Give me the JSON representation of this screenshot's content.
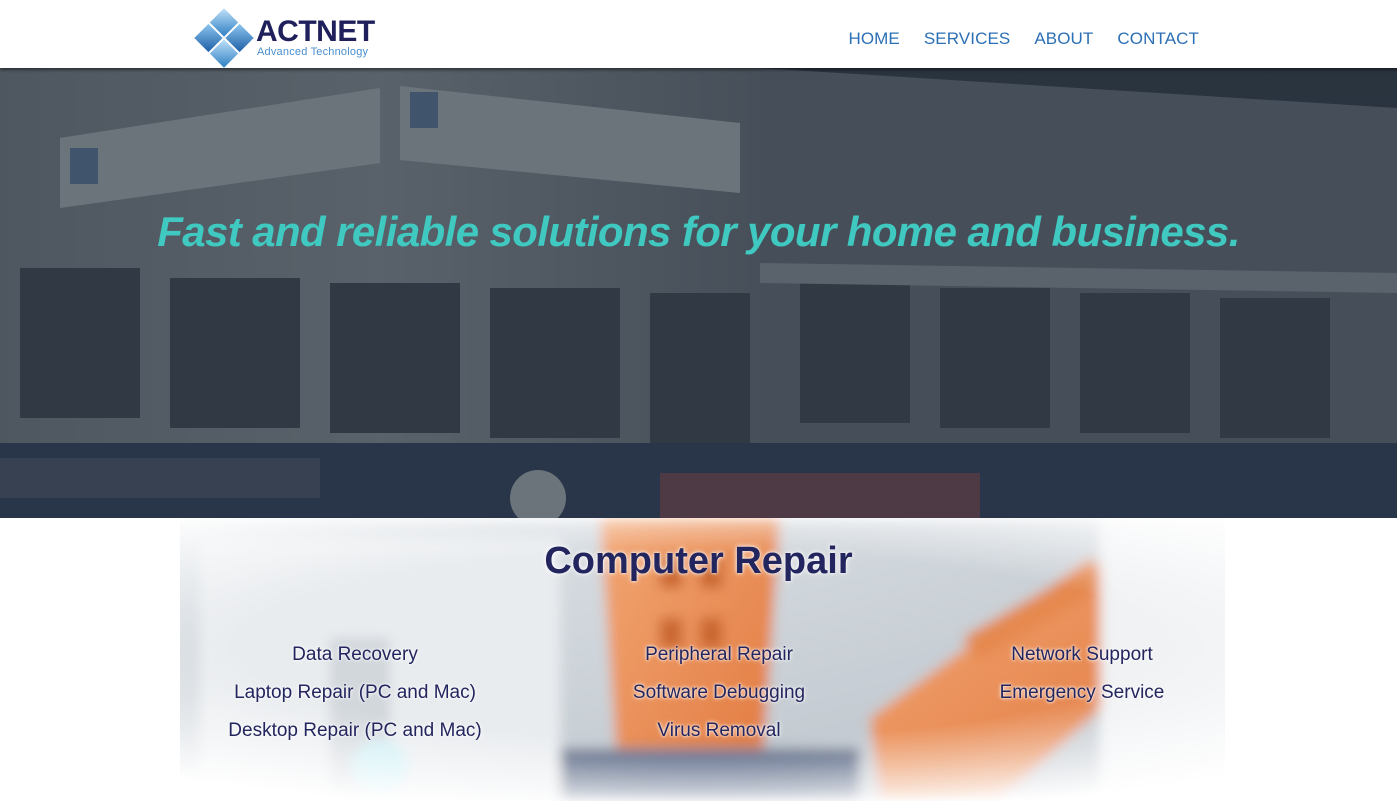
{
  "header": {
    "logo": {
      "name": "ACTNET",
      "tagline": "Advanced Technology",
      "icon": "diamond-grid-logo-icon"
    },
    "nav": [
      {
        "label": "HOME"
      },
      {
        "label": "SERVICES"
      },
      {
        "label": "ABOUT"
      },
      {
        "label": "CONTACT"
      }
    ]
  },
  "hero": {
    "title": "Fast and reliable solutions for your home and business."
  },
  "services": {
    "title": "Computer Repair",
    "columns": [
      [
        "Data Recovery",
        "Laptop Repair (PC and Mac)",
        "Desktop Repair (PC and Mac)"
      ],
      [
        "Peripheral Repair",
        "Software Debugging",
        "Virus Removal"
      ],
      [
        "Network Support",
        "Emergency Service"
      ]
    ]
  },
  "colors": {
    "nav_link": "#2b6fb5",
    "hero_title": "#3fc9c0",
    "heading": "#23255e",
    "logo_text": "#1f1f5c",
    "logo_tagline": "#4a8fcf"
  }
}
